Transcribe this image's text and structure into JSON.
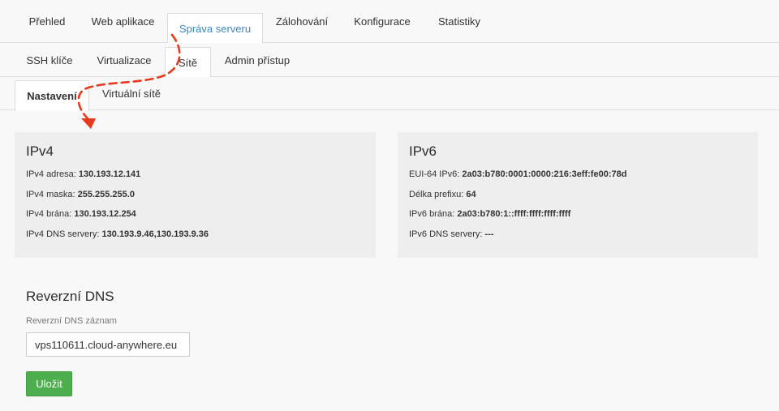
{
  "tabs_main": [
    {
      "label": "Přehled"
    },
    {
      "label": "Web aplikace"
    },
    {
      "label": "Správa serveru"
    },
    {
      "label": "Zálohování"
    },
    {
      "label": "Konfigurace"
    },
    {
      "label": "Statistiky"
    }
  ],
  "tabs_sub": [
    {
      "label": "SSH klíče"
    },
    {
      "label": "Virtualizace"
    },
    {
      "label": "Sítě"
    },
    {
      "label": "Admin přístup"
    }
  ],
  "tabs_inner": [
    {
      "label": "Nastavení"
    },
    {
      "label": "Virtuální sítě"
    }
  ],
  "ipv4": {
    "title": "IPv4",
    "rows": [
      {
        "label": "IPv4 adresa:",
        "value": "130.193.12.141"
      },
      {
        "label": "IPv4 maska:",
        "value": "255.255.255.0"
      },
      {
        "label": "IPv4 brána:",
        "value": "130.193.12.254"
      },
      {
        "label": "IPv4 DNS servery:",
        "value": "130.193.9.46,130.193.9.36"
      }
    ]
  },
  "ipv6": {
    "title": "IPv6",
    "rows": [
      {
        "label": "EUI-64 IPv6:",
        "value": "2a03:b780:0001:0000:216:3eff:fe00:78d"
      },
      {
        "label": "Délka prefixu:",
        "value": "64"
      },
      {
        "label": "IPv6 brána:",
        "value": "2a03:b780:1::ffff:ffff:ffff:ffff"
      },
      {
        "label": "IPv6 DNS servery:",
        "value": "---"
      }
    ]
  },
  "rdns": {
    "title": "Reverzní DNS",
    "field_label": "Reverzní DNS záznam",
    "value": "vps110611.cloud-anywhere.eu",
    "save_label": "Uložit"
  },
  "colors": {
    "active_tab_text": "#3d86c6",
    "save_button": "#4cae4c",
    "annotation_arrow": "#e8391e"
  }
}
